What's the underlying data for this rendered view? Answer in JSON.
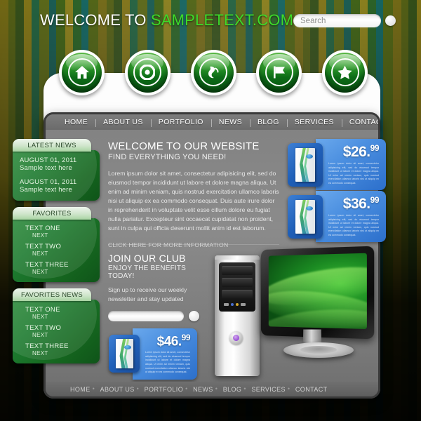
{
  "header": {
    "welcome_prefix": "WELCOME TO ",
    "brand": "SAMPLETEXT.COM",
    "search_placeholder": "Search",
    "search_value": ""
  },
  "icon_buttons": [
    {
      "name": "home-icon",
      "label": "Home"
    },
    {
      "name": "disc-icon",
      "label": "Media"
    },
    {
      "name": "phone-icon",
      "label": "Contact"
    },
    {
      "name": "flag-icon",
      "label": "Bookmarks"
    },
    {
      "name": "star-icon",
      "label": "Favorites"
    }
  ],
  "top_nav": [
    "HOME",
    "ABOUT US",
    "PORTFOLIO",
    "NEWS",
    "BLOG",
    "SERVICES",
    "CONTACT"
  ],
  "footer_nav": [
    "HOME",
    "ABOUT US",
    "PORTFOLIO",
    "NEWS",
    "BLOG",
    "SERVICES",
    "CONTACT"
  ],
  "sidebar": {
    "latest_news": {
      "title": "LATEST NEWS",
      "items": [
        {
          "date": "AUGUST 01, 2011",
          "text": "Sample text here"
        },
        {
          "date": "AUGUST 01, 2011",
          "text": "Sample text here"
        }
      ]
    },
    "favorites": {
      "title": "FAVORITES",
      "items": [
        {
          "title": "TEXT ONE",
          "sub": "NEXT"
        },
        {
          "title": "TEXT  TWO",
          "sub": "NEXT"
        },
        {
          "title": "TEXT  THREE",
          "sub": "NEXT"
        }
      ]
    },
    "favorites_news": {
      "title": "FAVORITES NEWS",
      "items": [
        {
          "title": "TEXT ONE",
          "sub": "NEXT"
        },
        {
          "title": "TEXT  TWO",
          "sub": "NEXT"
        },
        {
          "title": "TEXT  THREE",
          "sub": "NEXT"
        }
      ]
    }
  },
  "content": {
    "heading": "WELCOME TO OUR WEBSITE",
    "subheading": "FIND EVERYTHING YOU NEED!",
    "body": "Lorem ipsum dolor sit amet, consectetur adipisicing elit, sed do eiusmod tempor incididunt ut labore et dolore magna aliqua. Ut enim ad minim veniam, quis nostrud exercitation ullamco laboris nisi ut aliquip ex ea commodo consequat. Duis aute irure dolor in reprehenderit in voluptate velit esse cillum dolore eu fugiat nulla pariatur. Excepteur sint occaecat cupidatat non proident, sunt in culpa qui officia deserunt mollit anim id est laborum.",
    "more_link": "CLICK HERE FOR MORE INFORMATION"
  },
  "join_club": {
    "heading": "JOIN OUR CLUB",
    "subheading": "ENJOY THE BENEFITS TODAY!",
    "text": "Sign up to receive our weekly newsletter and stay updated",
    "input_value": "",
    "input_placeholder": ""
  },
  "price_boxes": [
    {
      "dollars": "$26.",
      "cents": "99",
      "desc": "Lorem ipsum dolor sit amet, consectetur adipisicing elit, sed do eiusmod tempor incididunt ut labore et dolore magna aliqua. Ut enim ad minim veniam, quis nostrud exercitation ullamco laboris nisi ut aliquip ex ea commodo consequat."
    },
    {
      "dollars": "$36.",
      "cents": "99",
      "desc": "Lorem ipsum dolor sit amet, consectetur adipisicing elit, sed do eiusmod tempor incididunt ut labore et dolore magna aliqua. Ut enim ad minim veniam, quis nostrud exercitation ullamco laboris nisi ut aliquip ex ea commodo consequat."
    },
    {
      "dollars": "$46.",
      "cents": "99",
      "desc": "Lorem ipsum dolor sit amet, consectetur adipisicing elit, sed do eiusmod tempor incididunt ut labore et dolore magna aliqua. Ut enim ad minim veniam, quis nostrud exercitation ullamco laboris nisi ut aliquip ex ea commodo consequat."
    }
  ],
  "colors": {
    "brand_green": "#3ddb2a",
    "orb_green": "#0c6b17",
    "panel_gray": "#838383",
    "price_blue": "#2c6fcb",
    "screen_green": "#1b8a22"
  }
}
